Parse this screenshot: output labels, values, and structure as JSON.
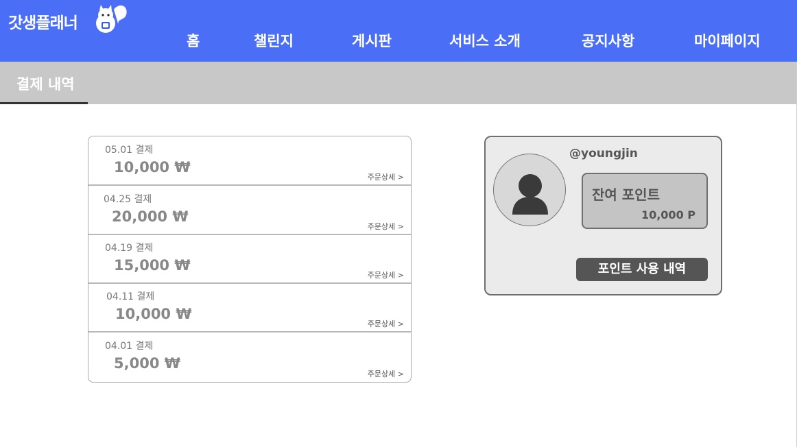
{
  "app": {
    "logo_text": "갓생플래너"
  },
  "nav": {
    "items": [
      "홈",
      "챌린지",
      "게시판",
      "서비스 소개",
      "공지사항",
      "마이페이지"
    ]
  },
  "page": {
    "title": "결제 내역"
  },
  "payments": [
    {
      "date": "05.01 결제",
      "amount": "10,000 ₩",
      "detail": "주문상세 >"
    },
    {
      "date": "04.25 결제",
      "amount": "20,000 ₩",
      "detail": "주문상세 >"
    },
    {
      "date": "04.19 결제",
      "amount": "15,000 ₩",
      "detail": "주문상세 >"
    },
    {
      "date": "04.11 결제",
      "amount": "10,000 ₩",
      "detail": "주문상세 >"
    },
    {
      "date": "04.01 결제",
      "amount": "5,000 ₩",
      "detail": "주문상세 >"
    }
  ],
  "profile": {
    "username": "@youngjin",
    "points_label": "잔여 포인트",
    "points_value": "10,000 P",
    "history_button": "포인트 사용 내역"
  },
  "colors": {
    "brand": "#4a6ef5",
    "subbar": "#c8c8c8",
    "button": "#555555"
  }
}
